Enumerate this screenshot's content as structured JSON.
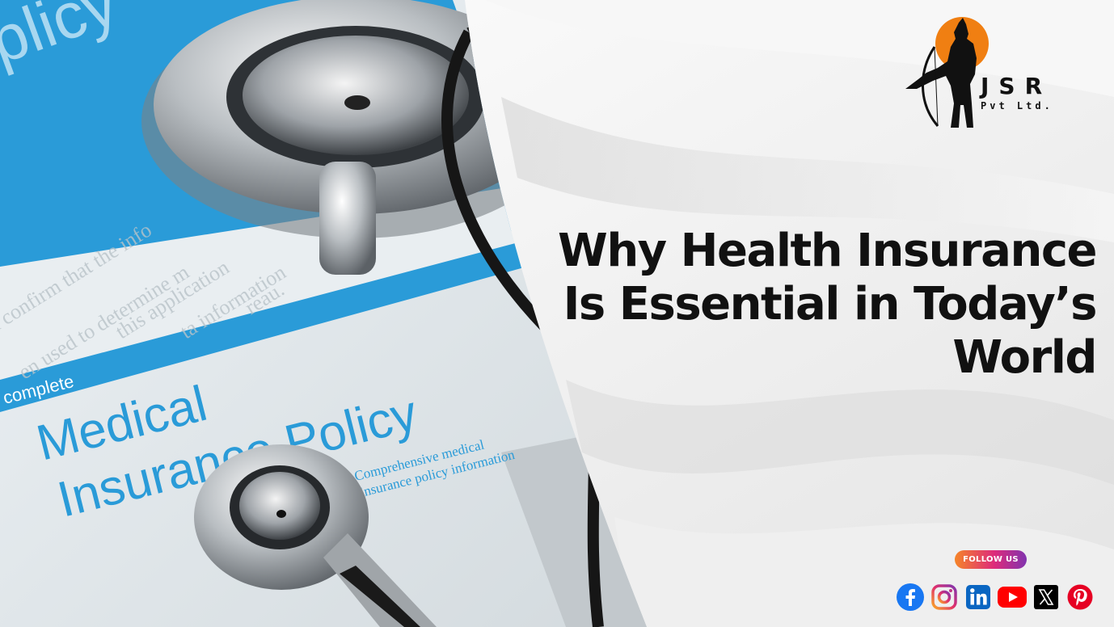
{
  "headline": {
    "line1": "Why Health Insurance",
    "line2": "Is Essential in Today’s",
    "line3": "World"
  },
  "logo": {
    "main": "JSR",
    "sub": "Pvt Ltd."
  },
  "photo": {
    "corner_text": "plicy",
    "small_lines": [
      "nd confirm that the info",
      "en used to determine m",
      "this application",
      "ta information",
      "reau."
    ],
    "cover_label": "complete",
    "cover_title_line1": "Medical",
    "cover_title_line2": "Insurance Policy",
    "cover_subtitle_line1": "Comprehensive medical",
    "cover_subtitle_line2": "insurance policy information"
  },
  "follow_label": "FOLLOW US",
  "socials": [
    {
      "name": "facebook-icon",
      "color": "#1877f2"
    },
    {
      "name": "instagram-icon",
      "color": "#dd2a7b"
    },
    {
      "name": "linkedin-icon",
      "color": "#0a66c2"
    },
    {
      "name": "youtube-icon",
      "color": "#ff0000"
    },
    {
      "name": "x-icon",
      "color": "#000000"
    },
    {
      "name": "pinterest-icon",
      "color": "#e60023"
    }
  ],
  "colors": {
    "accent_blue": "#2a9bd8",
    "logo_sun": "#f07f12",
    "headline": "#111111"
  }
}
